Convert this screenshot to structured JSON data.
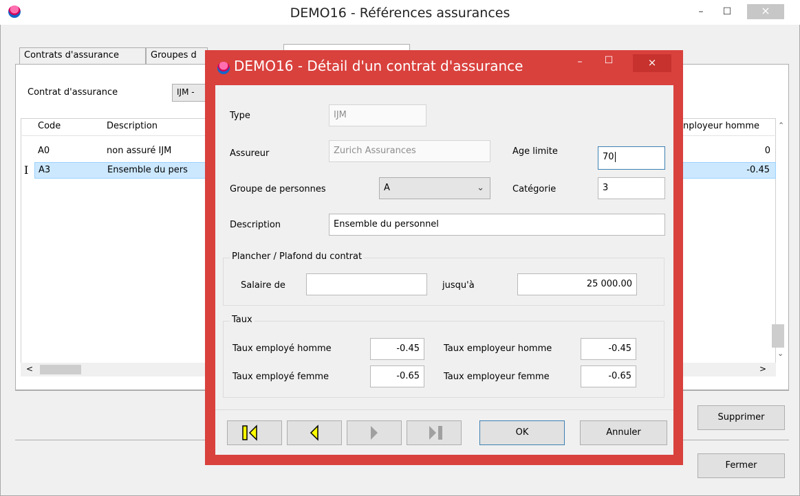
{
  "main_window": {
    "title": "DEMO16 - Références assurances",
    "controls": {
      "minimize": "–",
      "maximize": "☐",
      "close": "×"
    }
  },
  "tabs": [
    "Contrats d'assurance",
    "Groupes d"
  ],
  "filter": {
    "label": "Contrat d'assurance",
    "value": "IJM -"
  },
  "grid": {
    "columns": [
      "Code",
      "Description",
      "nployeur homme"
    ],
    "rows": [
      {
        "code": "A0",
        "description": "non assuré IJM",
        "employer_male": "0"
      },
      {
        "code": "A3",
        "description": "Ensemble du pers",
        "employer_male": "-0.45",
        "selected": true
      }
    ],
    "row_marker": "I"
  },
  "main_buttons": {
    "delete": "Supprimer",
    "close": "Fermer"
  },
  "dialog": {
    "title": "DEMO16 - Détail d'un contrat d'assurance",
    "controls": {
      "minimize": "–",
      "maximize": "☐",
      "close": "×"
    },
    "type": {
      "label": "Type",
      "value": "IJM"
    },
    "insurer": {
      "label": "Assureur",
      "value": "Zurich Assurances"
    },
    "age_limit": {
      "label": "Age limite",
      "value": "70"
    },
    "group": {
      "label": "Groupe de personnes",
      "value": "A"
    },
    "category": {
      "label": "Catégorie",
      "value": "3"
    },
    "description": {
      "label": "Description",
      "value": "Ensemble du personnel"
    },
    "floor_ceiling": {
      "title": "Plancher / Plafond du contrat",
      "salary_from_label": "Salaire de",
      "salary_from_value": "",
      "to_label": "jusqu'à",
      "to_value": "25 000.00"
    },
    "rates": {
      "title": "Taux",
      "employee_male_label": "Taux employé homme",
      "employee_male_value": "-0.45",
      "employee_female_label": "Taux employé femme",
      "employee_female_value": "-0.65",
      "employer_male_label": "Taux employeur homme",
      "employer_male_value": "-0.45",
      "employer_female_label": "Taux employeur femme",
      "employer_female_value": "-0.65"
    },
    "buttons": {
      "ok": "OK",
      "cancel": "Annuler"
    },
    "nav_icons": [
      "first-record-icon",
      "previous-record-icon",
      "next-record-icon",
      "last-record-icon"
    ],
    "colors": {
      "border": "#d9413d",
      "nav_active": "#ffff00",
      "nav_disabled": "#a0a0a0"
    }
  }
}
